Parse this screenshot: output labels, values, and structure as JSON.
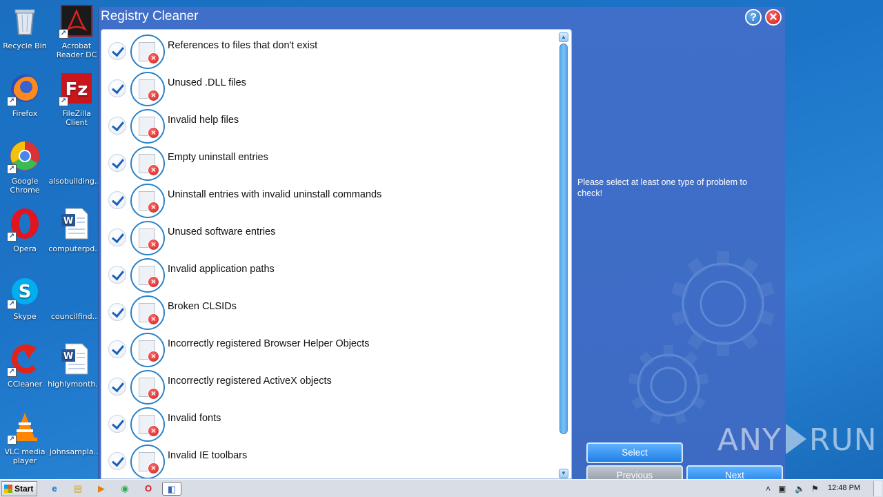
{
  "desktop": {
    "icons": [
      {
        "name": "Recycle Bin",
        "label": "Recycle Bin",
        "icon": "recycle-bin-icon"
      },
      {
        "name": "Acrobat Reader DC",
        "label": "Acrobat Reader DC",
        "icon": "acrobat-icon"
      },
      {
        "name": "Firefox",
        "label": "Firefox",
        "icon": "firefox-icon"
      },
      {
        "name": "FileZilla Client",
        "label": "FileZilla Client",
        "icon": "filezilla-icon"
      },
      {
        "name": "Google Chrome",
        "label": "Google Chrome",
        "icon": "chrome-icon"
      },
      {
        "name": "alsobuilding",
        "label": "alsobuilding...",
        "icon": "blank-file-icon"
      },
      {
        "name": "Opera",
        "label": "Opera",
        "icon": "opera-icon"
      },
      {
        "name": "computerpd",
        "label": "computerpd...",
        "icon": "word-document-icon"
      },
      {
        "name": "Skype",
        "label": "Skype",
        "icon": "skype-icon"
      },
      {
        "name": "councilfind",
        "label": "councilfind...",
        "icon": "blank-file-icon"
      },
      {
        "name": "CCleaner",
        "label": "CCleaner",
        "icon": "ccleaner-icon"
      },
      {
        "name": "highlymonth",
        "label": "highlymonth...",
        "icon": "word-document-icon"
      },
      {
        "name": "VLC media player",
        "label": "VLC media player",
        "icon": "vlc-icon"
      },
      {
        "name": "johnsampla",
        "label": "johnsampla...",
        "icon": "blank-file-icon"
      }
    ]
  },
  "window": {
    "title": "Registry Cleaner",
    "help_label": "?",
    "close_label": "✕",
    "items": [
      {
        "label": "References to files that don't exist",
        "checked": true,
        "icon": "missing-file-icon"
      },
      {
        "label": "Unused .DLL files",
        "checked": true,
        "icon": "dll-file-icon"
      },
      {
        "label": "Invalid help files",
        "checked": true,
        "icon": "help-file-icon"
      },
      {
        "label": "Empty uninstall entries",
        "checked": true,
        "icon": "monitor-icon"
      },
      {
        "label": "Uninstall entries with invalid uninstall commands",
        "checked": true,
        "icon": "document-icon"
      },
      {
        "label": "Unused software entries",
        "checked": true,
        "icon": "window-icon"
      },
      {
        "label": "Invalid application paths",
        "checked": true,
        "icon": "folder-icon"
      },
      {
        "label": "Broken CLSIDs",
        "checked": true,
        "icon": "application-window-icon"
      },
      {
        "label": "Incorrectly registered Browser Helper Objects",
        "checked": true,
        "icon": "database-icon"
      },
      {
        "label": "Incorrectly registered ActiveX objects",
        "checked": true,
        "icon": "gear-icon"
      },
      {
        "label": "Invalid fonts",
        "checked": true,
        "icon": "font-icon"
      },
      {
        "label": "Invalid IE toolbars",
        "checked": true,
        "icon": "toolbar-icon"
      }
    ],
    "info_text": "Please select at least one type of problem to check!",
    "buttons": {
      "select": "Select",
      "previous": "Previous",
      "next": "Next"
    }
  },
  "watermark": {
    "left": "ANY",
    "right": "RUN"
  },
  "taskbar": {
    "start_label": "Start",
    "items": [
      {
        "name": "internet-explorer",
        "glyph": "e"
      },
      {
        "name": "file-explorer",
        "glyph": "▤"
      },
      {
        "name": "media-player",
        "glyph": "▶"
      },
      {
        "name": "chrome",
        "glyph": "◉"
      },
      {
        "name": "opera",
        "glyph": "O"
      },
      {
        "name": "registry-cleaner-task",
        "glyph": "◧"
      }
    ],
    "tray": {
      "up_arrow": "˄",
      "time": "12:48 PM"
    }
  },
  "colors": {
    "desktop_bg": "#1c74c8",
    "window_bg": "#3f6fc9",
    "button_blue": "#2f8ef0",
    "button_gray": "#9aa2ab",
    "check_blue": "#1d5fb8",
    "error_red": "#d21919"
  }
}
